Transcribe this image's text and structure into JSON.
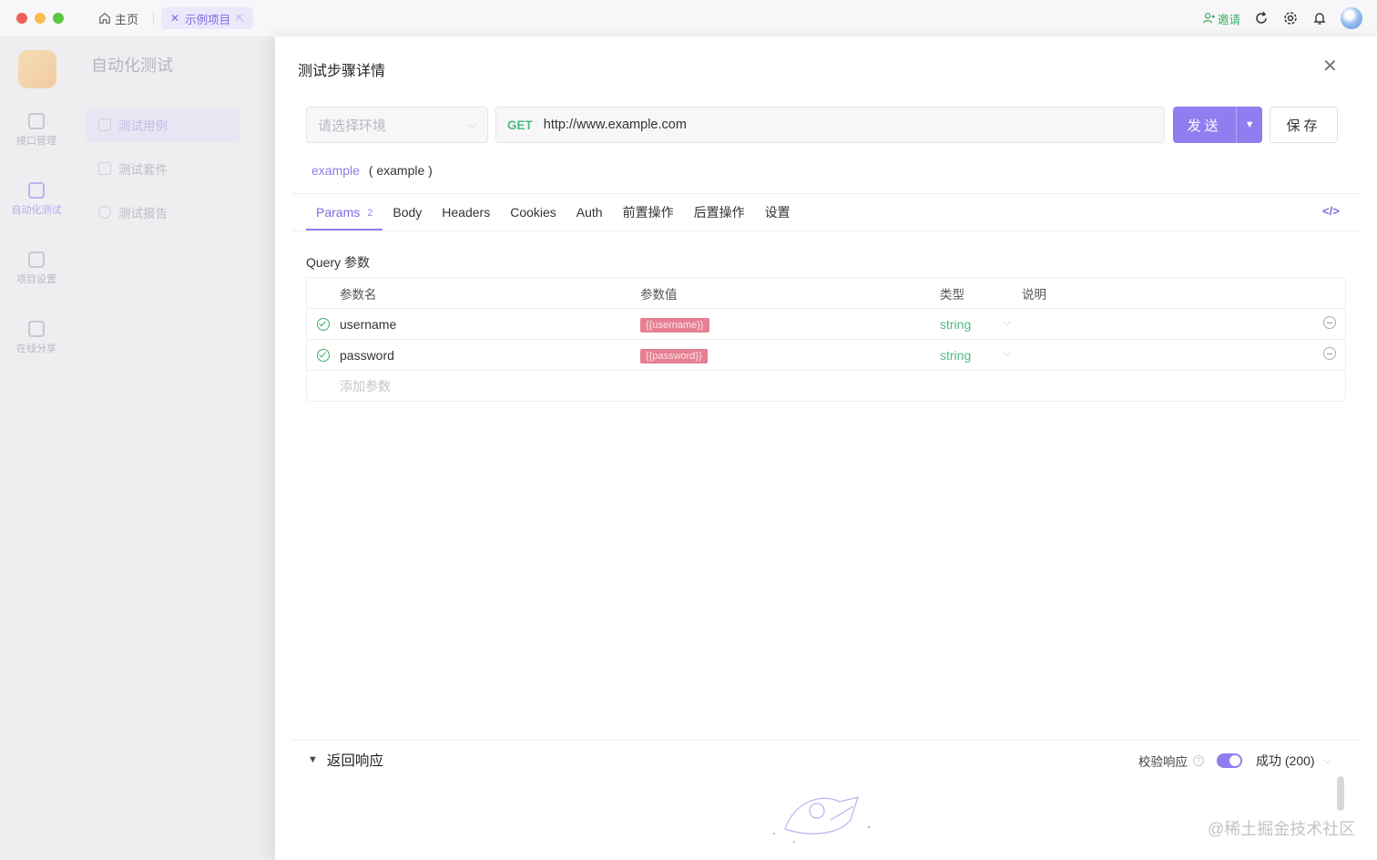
{
  "titlebar": {
    "home_tab": "主页",
    "project_tab": "示例项目",
    "invite": "邀请"
  },
  "app": {
    "module_title": "自动化测试",
    "rail": [
      {
        "label": "接口管理"
      },
      {
        "label": "自动化测试"
      },
      {
        "label": "项目设置"
      },
      {
        "label": "在线分享"
      }
    ],
    "menu": [
      {
        "label": "测试用例"
      },
      {
        "label": "测试套件"
      },
      {
        "label": "测试报告"
      }
    ]
  },
  "drawer": {
    "title": "测试步骤详情",
    "env_placeholder": "请选择环境",
    "method": "GET",
    "url": "http://www.example.com",
    "send_label": "发送",
    "save_label": "保存",
    "case_link": "example",
    "case_name": "( example )",
    "tabs": [
      {
        "label": "Params",
        "count": "2"
      },
      {
        "label": "Body"
      },
      {
        "label": "Headers"
      },
      {
        "label": "Cookies"
      },
      {
        "label": "Auth"
      },
      {
        "label": "前置操作"
      },
      {
        "label": "后置操作"
      },
      {
        "label": "设置"
      }
    ],
    "query_title": "Query 参数",
    "columns": {
      "name": "参数名",
      "value": "参数值",
      "type": "类型",
      "desc": "说明"
    },
    "params": [
      {
        "name": "username",
        "value": "{{username}}",
        "type": "string",
        "desc": ""
      },
      {
        "name": "password",
        "value": "{{password}}",
        "type": "string",
        "desc": ""
      }
    ],
    "add_param": "添加参数",
    "response_title": "返回响应",
    "validate_label": "校验响应",
    "validate_on": true,
    "status_select": "成功 (200)"
  },
  "watermark": "@稀土掘金技术社区",
  "colors": {
    "accent": "#8f7ef0",
    "get": "#4cbc83",
    "variable": "#e57f91"
  }
}
